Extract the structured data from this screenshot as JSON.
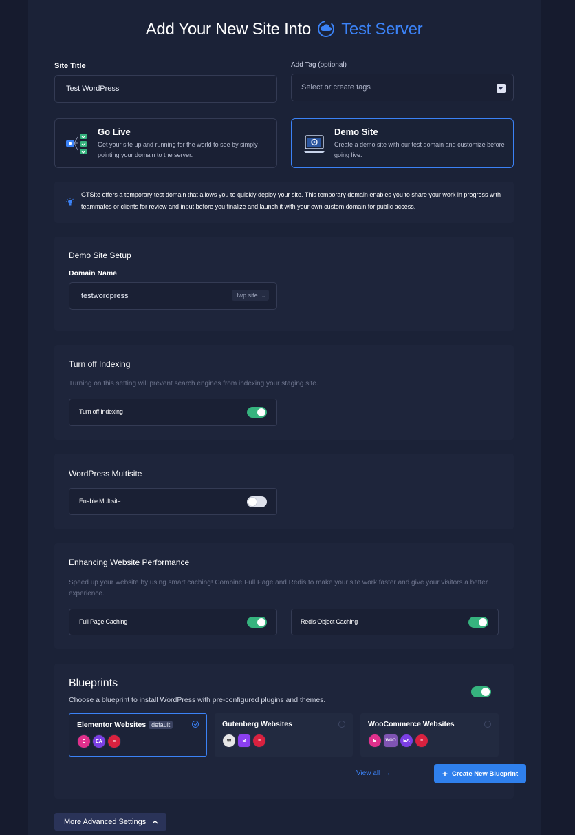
{
  "header": {
    "title_prefix": "Add Your New Site Into",
    "server_name": "Test Server"
  },
  "form": {
    "site_title_label": "Site Title",
    "site_title_value": "Test WordPress",
    "tag_label": "Add Tag (optional)",
    "tag_placeholder": "Select or create tags"
  },
  "modes": [
    {
      "title": "Go Live",
      "desc": "Get your site up and running for the world to see by simply pointing your domain to the server.",
      "selected": false
    },
    {
      "title": "Demo Site",
      "desc": "Create a demo site with our test domain and customize before going live.",
      "selected": true
    }
  ],
  "info_notice": "GTSite offers a temporary test domain that allows you to quickly deploy your site. This temporary domain enables you to share your work in progress with teammates or clients for review and input before you finalize and launch it with your own custom domain for public access.",
  "demo_setup": {
    "title": "Demo Site Setup",
    "domain_label": "Domain Name",
    "domain_value": "testwordpress",
    "domain_suffix": ".lwp.site"
  },
  "indexing": {
    "title": "Turn off Indexing",
    "desc": "Turning on this setting will prevent search engines from indexing your staging site.",
    "toggle_label": "Turn off Indexing",
    "enabled": true
  },
  "multisite": {
    "title": "WordPress Multisite",
    "toggle_label": "Enable Multisite",
    "enabled": false
  },
  "performance": {
    "title": "Enhancing Website Performance",
    "desc": "Speed up your website by using smart caching! Combine Full Page and Redis to make your site work faster and give your visitors a better experience.",
    "full_page_label": "Full Page Caching",
    "full_page_enabled": true,
    "redis_label": "Redis Object Caching",
    "redis_enabled": true
  },
  "blueprints": {
    "title": "Blueprints",
    "desc": "Choose a blueprint to install WordPress with pre-configured plugins and themes.",
    "enabled": true,
    "items": [
      {
        "name": "Elementor Websites",
        "badge": "default",
        "selected": true
      },
      {
        "name": "Gutenberg Websites",
        "selected": false
      },
      {
        "name": "WooCommerce Websites",
        "selected": false
      }
    ],
    "view_all": "View all",
    "create_button": "Create New Blueprint",
    "plugin_woo": "WOO"
  },
  "advanced_button": "More Advanced Settings",
  "colors": {
    "accent": "#3b82f6",
    "toggle_on": "#36b37e",
    "background": "#1b2237"
  }
}
